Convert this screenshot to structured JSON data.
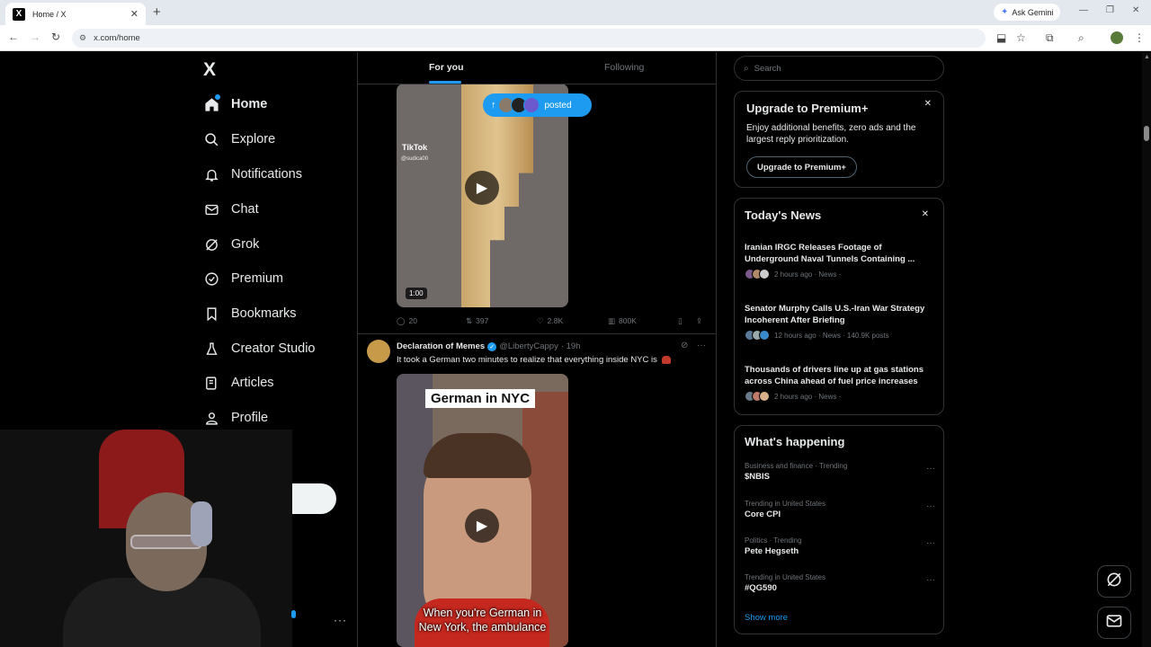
{
  "browser": {
    "tab_title": "Home / X",
    "tab_favicon": "X",
    "new_tab": "+",
    "ask_gemini": "Ask Gemini",
    "url": "x.com/home"
  },
  "nav": {
    "logo": "X",
    "items": [
      {
        "label": "Home",
        "icon": "home-icon"
      },
      {
        "label": "Explore",
        "icon": "search-icon"
      },
      {
        "label": "Notifications",
        "icon": "bell-icon"
      },
      {
        "label": "Chat",
        "icon": "mail-icon"
      },
      {
        "label": "Grok",
        "icon": "grok-icon"
      },
      {
        "label": "Premium",
        "icon": "premium-icon"
      },
      {
        "label": "Bookmarks",
        "icon": "bookmark-icon"
      },
      {
        "label": "Creator Studio",
        "icon": "flask-icon"
      },
      {
        "label": "Articles",
        "icon": "article-icon"
      },
      {
        "label": "Profile",
        "icon": "person-icon"
      }
    ],
    "more": "···"
  },
  "feed": {
    "tab_for_you": "For you",
    "tab_following": "Following",
    "posted_pill": "posted",
    "tweet1": {
      "video_watermark": "TikTok",
      "video_handle": "@sudica00",
      "duration": "1:00",
      "replies": "20",
      "reposts": "397",
      "likes": "2.8K",
      "views": "800K"
    },
    "tweet2": {
      "name": "Declaration of Memes",
      "handle": "@LibertyCappy",
      "time": "· 19h",
      "text": "It took a German two minutes to realize that everything inside NYC is",
      "video_caption": "German in NYC",
      "video_subtitle_1": "When you're German in",
      "video_subtitle_2": "New York, the ambulance"
    }
  },
  "right": {
    "search_placeholder": "Search",
    "premium": {
      "title": "Upgrade to Premium+",
      "desc": "Enjoy additional benefits, zero ads and the largest reply prioritization.",
      "button": "Upgrade to Premium+"
    },
    "news": {
      "title": "Today's News",
      "items": [
        {
          "headline": "Iranian IRGC Releases Footage of Underground Naval Tunnels Containing ...",
          "meta": "2 hours ago · News ·"
        },
        {
          "headline": "Senator Murphy Calls U.S.-Iran War Strategy Incoherent After Briefing",
          "meta": "12 hours ago · News · 140.9K posts"
        },
        {
          "headline": "Thousands of drivers line up at gas stations across China ahead of fuel price increases",
          "meta": "2 hours ago · News ·"
        }
      ]
    },
    "happening": {
      "title": "What's happening",
      "trends": [
        {
          "context": "Business and finance · Trending",
          "name": "$NBIS"
        },
        {
          "context": "Trending in United States",
          "name": "Core CPI"
        },
        {
          "context": "Politics · Trending",
          "name": "Pete Hegseth"
        },
        {
          "context": "Trending in United States",
          "name": "#QG590"
        }
      ],
      "show_more": "Show more"
    }
  },
  "colors": {
    "accent": "#1d9bf0",
    "background": "#000000",
    "border": "#2f3336",
    "muted_text": "#71767b"
  }
}
